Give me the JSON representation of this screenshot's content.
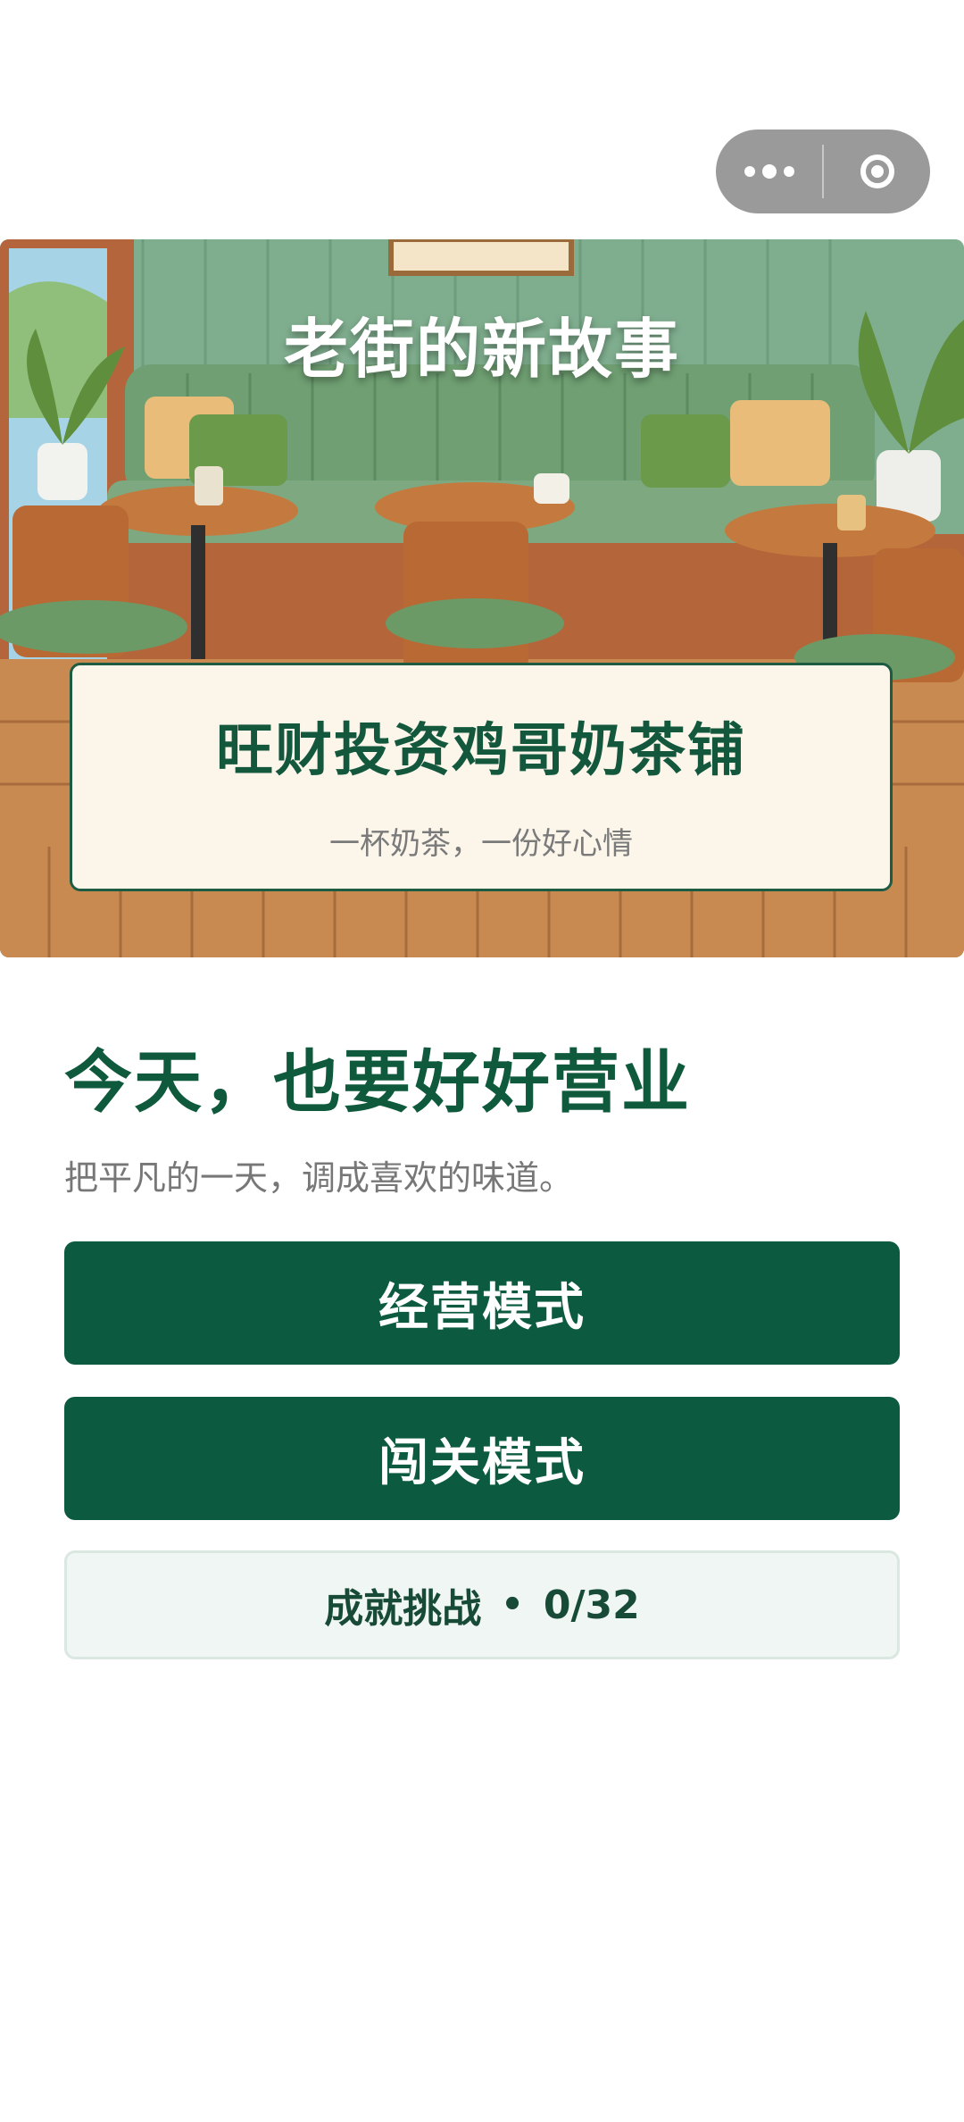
{
  "header": {
    "menu_icon": "more-dots-icon",
    "close_icon": "target-circle-icon"
  },
  "hero": {
    "title": "老街的新故事",
    "shop_name": "旺财投资鸡哥奶茶铺",
    "slogan": "一杯奶茶，一份好心情"
  },
  "main": {
    "headline": "今天，也要好好营业",
    "subline": "把平凡的一天，调成喜欢的味道。",
    "business_mode_label": "经营模式",
    "level_mode_label": "闯关模式",
    "achievement": {
      "label": "成就挑战",
      "separator": "•",
      "progress": "0/32"
    }
  },
  "colors": {
    "primary": "#0c5a40",
    "accent_text": "#0f5a3c"
  }
}
